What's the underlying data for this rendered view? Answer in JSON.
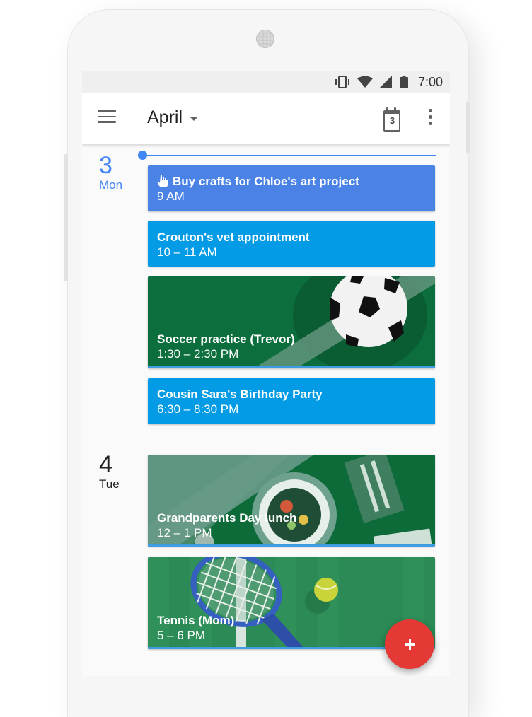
{
  "status_bar": {
    "time": "7:00",
    "icons": [
      "vibrate-icon",
      "wifi-icon",
      "signal-icon",
      "battery-icon"
    ]
  },
  "app_bar": {
    "menu_icon": "hamburger-menu-icon",
    "month": "April",
    "today_date": "3",
    "today_icon": "calendar-today-icon",
    "overflow_icon": "more-vert-icon"
  },
  "days": [
    {
      "number": "3",
      "weekday": "Mon",
      "is_today": true,
      "color": "#4285f4",
      "events": [
        {
          "title": "Buy crafts for Chloe's art project",
          "time": "9 AM",
          "color": "#4a82e6",
          "icon": "reminder-hand-icon"
        },
        {
          "title": "Crouton's vet appointment",
          "time": "10 – 11 AM",
          "color": "#039be5"
        },
        {
          "title": "Soccer practice (Trevor)",
          "time": "1:30 – 2:30 PM",
          "color": "#0b6e3c",
          "illustration": "soccer-ball"
        },
        {
          "title": "Cousin Sara's Birthday Party",
          "time": "6:30 – 8:30 PM",
          "color": "#039be5"
        }
      ]
    },
    {
      "number": "4",
      "weekday": "Tue",
      "is_today": false,
      "color": "#212121",
      "events": [
        {
          "title": "Grandparents Day lunch",
          "time": "12 – 1 PM",
          "color": "#0d6b3a",
          "illustration": "lunch-plate"
        },
        {
          "title": "Tennis (Mom)",
          "time": "5 – 6 PM",
          "color": "#2e8b57",
          "illustration": "tennis-racket"
        }
      ]
    }
  ],
  "fab": {
    "icon": "plus-icon",
    "color": "#e53935"
  }
}
